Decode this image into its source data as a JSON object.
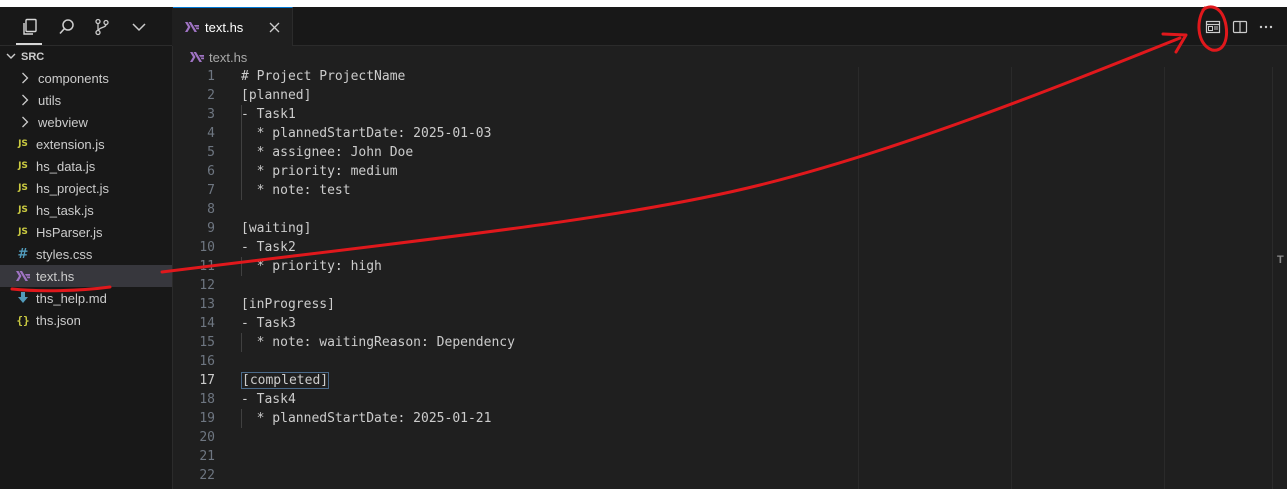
{
  "activity_bar": {
    "icons": [
      "explorer-icon",
      "search-icon",
      "source-control-icon",
      "chevron-down-icon"
    ]
  },
  "explorer": {
    "section_title": "SRC",
    "items": [
      {
        "label": "components",
        "kind": "folder",
        "icon": "chevron-right-icon"
      },
      {
        "label": "utils",
        "kind": "folder",
        "icon": "chevron-right-icon"
      },
      {
        "label": "webview",
        "kind": "folder",
        "icon": "chevron-right-icon"
      },
      {
        "label": "extension.js",
        "kind": "js",
        "icon_text": "JS"
      },
      {
        "label": "hs_data.js",
        "kind": "js",
        "icon_text": "JS"
      },
      {
        "label": "hs_project.js",
        "kind": "js",
        "icon_text": "JS"
      },
      {
        "label": "hs_task.js",
        "kind": "js",
        "icon_text": "JS"
      },
      {
        "label": "HsParser.js",
        "kind": "js",
        "icon_text": "JS"
      },
      {
        "label": "styles.css",
        "kind": "css",
        "icon_text": "#"
      },
      {
        "label": "text.hs",
        "kind": "haskell",
        "selected": true
      },
      {
        "label": "ths_help.md",
        "kind": "markdown"
      },
      {
        "label": "ths.json",
        "kind": "json",
        "icon_text": "{}"
      }
    ]
  },
  "tabs": [
    {
      "label": "text.hs",
      "active": true
    }
  ],
  "breadcrumb": {
    "file": "text.hs"
  },
  "toolbar_icons": [
    "open-preview-icon",
    "split-editor-icon",
    "more-actions-icon"
  ],
  "editor": {
    "current_line": 17,
    "lines": [
      {
        "n": "1",
        "text": "# Project ProjectName"
      },
      {
        "n": "2",
        "text": "[planned]"
      },
      {
        "n": "3",
        "text": "- Task1"
      },
      {
        "n": "4",
        "text": "  * plannedStartDate: 2025-01-03"
      },
      {
        "n": "5",
        "text": "  * assignee: John Doe"
      },
      {
        "n": "6",
        "text": "  * priority: medium"
      },
      {
        "n": "7",
        "text": "  * note: test"
      },
      {
        "n": "8",
        "text": ""
      },
      {
        "n": "9",
        "text": "[waiting]"
      },
      {
        "n": "10",
        "text": "- Task2"
      },
      {
        "n": "11",
        "text": "  * priority: high"
      },
      {
        "n": "12",
        "text": ""
      },
      {
        "n": "13",
        "text": "[inProgress]"
      },
      {
        "n": "14",
        "text": "- Task3"
      },
      {
        "n": "15",
        "text": "  * note: waitingReason: Dependency"
      },
      {
        "n": "16",
        "text": ""
      },
      {
        "n": "17",
        "text": "[completed]"
      },
      {
        "n": "18",
        "text": "- Task4"
      },
      {
        "n": "19",
        "text": "  * plannedStartDate: 2025-01-21"
      },
      {
        "n": "20",
        "text": ""
      },
      {
        "n": "21",
        "text": ""
      },
      {
        "n": "22",
        "text": ""
      }
    ]
  },
  "scrollbar": {
    "minimap_label": "T"
  },
  "colors": {
    "accent": "#0078d4",
    "annotation": "#e0181c",
    "haskell_icon": "#a074c4"
  }
}
